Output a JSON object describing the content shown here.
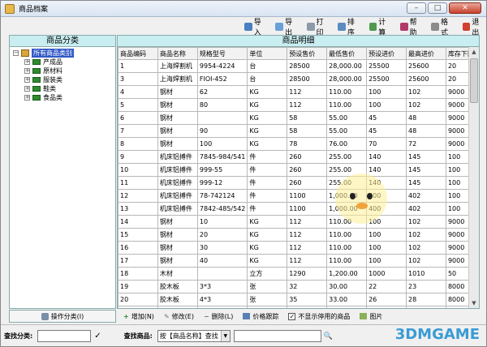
{
  "window": {
    "title": "商品档案",
    "minimize": "–",
    "maximize": "□",
    "close": "✕"
  },
  "toolbar": {
    "import": "导入",
    "export": "导出",
    "print": "打印",
    "sort": "排序",
    "calc": "计算",
    "help": "帮助",
    "format": "格式",
    "exit": "退出"
  },
  "tree": {
    "header": "商品分类",
    "root": "所有商品类别",
    "children": [
      "产成品",
      "原材料",
      "服装类",
      "鞋类",
      "食品类"
    ]
  },
  "table": {
    "header": "商品明细",
    "columns": [
      "商品编码",
      "商品名称",
      "规格型号",
      "单位",
      "预设售价",
      "最低售价",
      "预设进价",
      "最高进价",
      "库存下限"
    ],
    "rows": [
      [
        "1",
        "上海焊割机",
        "9954-4224",
        "台",
        "28500",
        "28,000.00",
        "25500",
        "25600",
        "20"
      ],
      [
        "3",
        "上海焊割机",
        "FIOI-452",
        "台",
        "28500",
        "28,000.00",
        "25500",
        "25600",
        "20"
      ],
      [
        "4",
        "钢材",
        "62",
        "KG",
        "112",
        "110.00",
        "100",
        "102",
        "9000"
      ],
      [
        "5",
        "钢材",
        "80",
        "KG",
        "112",
        "110.00",
        "100",
        "102",
        "9000"
      ],
      [
        "6",
        "钢材",
        "",
        "KG",
        "58",
        "55.00",
        "45",
        "48",
        "9000"
      ],
      [
        "7",
        "钢材",
        "90",
        "KG",
        "58",
        "55.00",
        "45",
        "48",
        "9000"
      ],
      [
        "8",
        "钢材",
        "100",
        "KG",
        "78",
        "76.00",
        "70",
        "72",
        "9000"
      ],
      [
        "9",
        "机床铝搏件",
        "7845-984/541",
        "件",
        "260",
        "255.00",
        "140",
        "145",
        "100"
      ],
      [
        "10",
        "机床铝搏件",
        "999-55",
        "件",
        "260",
        "255.00",
        "140",
        "145",
        "100"
      ],
      [
        "11",
        "机床铝搏件",
        "999-12",
        "件",
        "260",
        "255.00",
        "140",
        "145",
        "100"
      ],
      [
        "12",
        "机床铝搏件",
        "78-742124",
        "件",
        "1100",
        "1,000.00",
        "400",
        "402",
        "100"
      ],
      [
        "13",
        "机床铝搏件",
        "7842-485/542",
        "件",
        "1100",
        "1,000.00",
        "400",
        "402",
        "100"
      ],
      [
        "14",
        "钢材",
        "10",
        "KG",
        "112",
        "110.00",
        "100",
        "102",
        "9000"
      ],
      [
        "15",
        "钢材",
        "20",
        "KG",
        "112",
        "110.00",
        "100",
        "102",
        "9000"
      ],
      [
        "16",
        "钢材",
        "30",
        "KG",
        "112",
        "110.00",
        "100",
        "102",
        "9000"
      ],
      [
        "17",
        "钢材",
        "40",
        "KG",
        "112",
        "110.00",
        "100",
        "102",
        "9000"
      ],
      [
        "18",
        "木材",
        "",
        "立方",
        "1290",
        "1,200.00",
        "1000",
        "1010",
        "50"
      ],
      [
        "19",
        "胶木板",
        "3*3",
        "张",
        "32",
        "30.00",
        "22",
        "23",
        "8000"
      ],
      [
        "20",
        "胶木板",
        "4*3",
        "张",
        "35",
        "33.00",
        "26",
        "28",
        "8000"
      ],
      [
        "21",
        "胶木板",
        "4*4",
        "张",
        "38",
        "36.00",
        "22",
        "25",
        "8000"
      ]
    ]
  },
  "left_footer": {
    "op_category": "操作分类(I)"
  },
  "right_footer": {
    "add": "增加(N)",
    "edit": "修改(E)",
    "delete": "删除(L)",
    "price_track": "价格跟踪",
    "hide_disabled": "不显示停用的商品",
    "image": "图片"
  },
  "search": {
    "category_label": "查找分类:",
    "product_label": "查找商品:",
    "mode": "按【商品名称】查找"
  },
  "watermark": "3DMGAME"
}
